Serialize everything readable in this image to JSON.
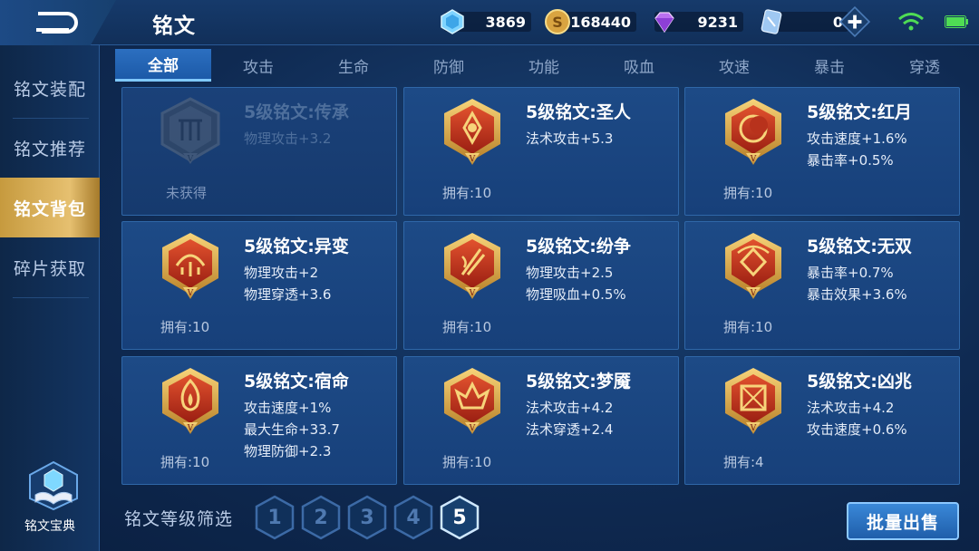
{
  "header": {
    "title": "铭文",
    "resources": [
      {
        "name": "crystal",
        "icon": "crystal-icon",
        "value": "3869"
      },
      {
        "name": "gold",
        "icon": "gold-coin-icon",
        "value": "168440"
      },
      {
        "name": "diamond",
        "icon": "diamond-icon",
        "value": "9231"
      },
      {
        "name": "vouchers",
        "icon": "voucher-icon",
        "value": "0"
      }
    ]
  },
  "sidebar": {
    "items": [
      {
        "label": "铭文装配"
      },
      {
        "label": "铭文推荐"
      },
      {
        "label": "铭文背包"
      },
      {
        "label": "碎片获取"
      }
    ],
    "active_index": 2,
    "codex_label": "铭文宝典"
  },
  "tabs": [
    {
      "label": "全部"
    },
    {
      "label": "攻击"
    },
    {
      "label": "生命"
    },
    {
      "label": "防御"
    },
    {
      "label": "功能"
    },
    {
      "label": "吸血"
    },
    {
      "label": "攻速"
    },
    {
      "label": "暴击"
    },
    {
      "label": "穿透"
    }
  ],
  "active_tab": 0,
  "cards": [
    {
      "name": "5级铭文:传承",
      "attrs": [
        "物理攻击+3.2"
      ],
      "own": "未获得",
      "locked": true
    },
    {
      "name": "5级铭文:圣人",
      "attrs": [
        "法术攻击+5.3"
      ],
      "own": "拥有:10",
      "locked": false
    },
    {
      "name": "5级铭文:红月",
      "attrs": [
        "攻击速度+1.6%",
        "暴击率+0.5%"
      ],
      "own": "拥有:10",
      "locked": false
    },
    {
      "name": "5级铭文:异变",
      "attrs": [
        "物理攻击+2",
        "物理穿透+3.6"
      ],
      "own": "拥有:10",
      "locked": false
    },
    {
      "name": "5级铭文:纷争",
      "attrs": [
        "物理攻击+2.5",
        "物理吸血+0.5%"
      ],
      "own": "拥有:10",
      "locked": false
    },
    {
      "name": "5级铭文:无双",
      "attrs": [
        "暴击率+0.7%",
        "暴击效果+3.6%"
      ],
      "own": "拥有:10",
      "locked": false
    },
    {
      "name": "5级铭文:宿命",
      "attrs": [
        "攻击速度+1%",
        "最大生命+33.7",
        "物理防御+2.3"
      ],
      "own": "拥有:10",
      "locked": false
    },
    {
      "name": "5级铭文:梦魇",
      "attrs": [
        "法术攻击+4.2",
        "法术穿透+2.4"
      ],
      "own": "拥有:10",
      "locked": false
    },
    {
      "name": "5级铭文:凶兆",
      "attrs": [
        "法术攻击+4.2",
        "攻击速度+0.6%"
      ],
      "own": "拥有:4",
      "locked": false
    }
  ],
  "footer": {
    "filter_label": "铭文等级筛选",
    "levels": [
      "1",
      "2",
      "3",
      "4",
      "5"
    ],
    "active_level": "5",
    "sell_label": "批量出售"
  },
  "colors": {
    "rune_red": "#c8321e",
    "rune_gold": "#e8b048",
    "active_gold": "#d9b060",
    "tab_blue": "#2c6fc0"
  }
}
